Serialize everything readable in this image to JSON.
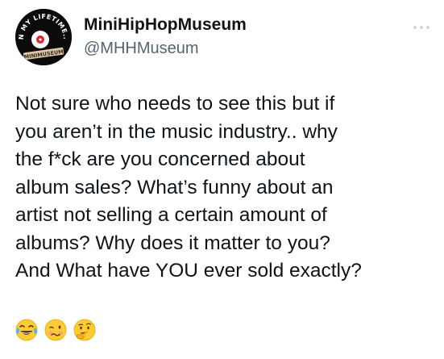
{
  "author": {
    "display_name": "MiniHipHopMuseum",
    "handle": "@MHHMuseum",
    "avatar_top_text": "IN MY LIFETIME...",
    "avatar_bottom_text": "MINIMUSEUM"
  },
  "tweet": {
    "lines": [
      "Not sure who needs to see this but if",
      "you aren’t in the music industry.. why",
      "the f*ck are you concerned about",
      "album sales? What’s funny about an",
      "artist not selling a certain amount of",
      "albums? Why does it matter to you?",
      "And What have YOU ever sold exactly?"
    ],
    "emojis": [
      "face-with-tears-of-joy",
      "woozy-face",
      "thinking-face"
    ]
  },
  "colors": {
    "text": "#0f1419",
    "secondary_text": "#536471",
    "emoji_yellow": "#ffcc33",
    "more_dots": "#cfd9de"
  },
  "icons": {
    "more": "more-horizontal-icon"
  }
}
